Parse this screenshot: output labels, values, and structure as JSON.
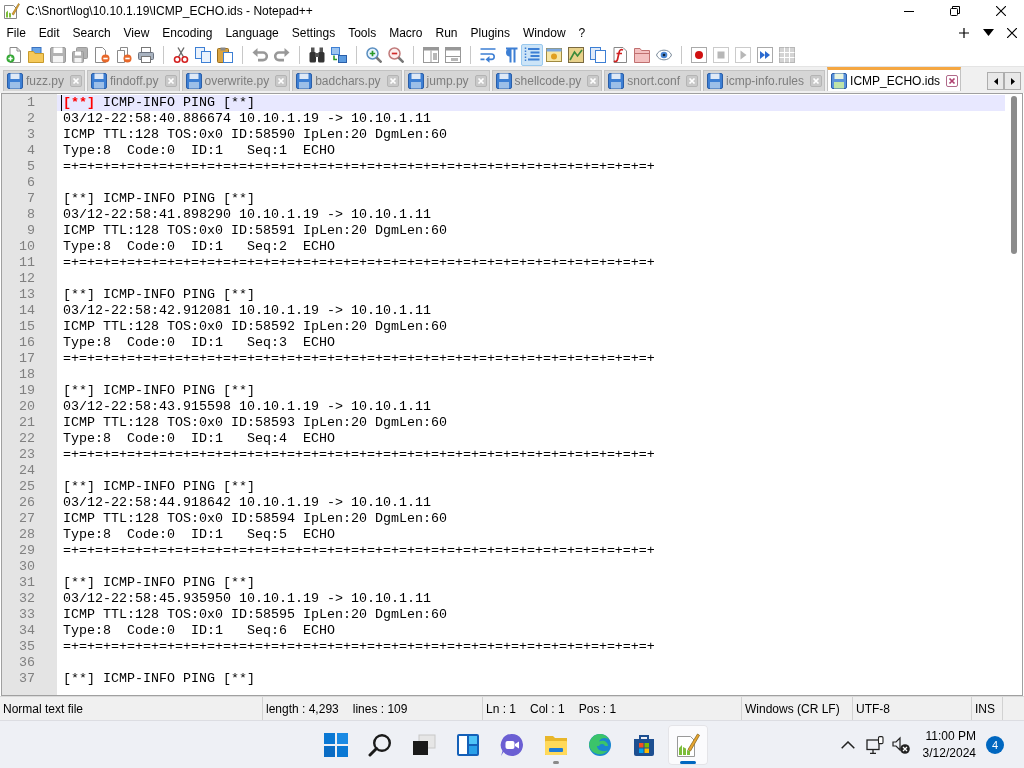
{
  "window": {
    "title": "C:\\Snort\\log\\10.10.1.19\\ICMP_ECHO.ids - Notepad++"
  },
  "menu": [
    "File",
    "Edit",
    "Search",
    "View",
    "Encoding",
    "Language",
    "Settings",
    "Tools",
    "Macro",
    "Run",
    "Plugins",
    "Window",
    "?"
  ],
  "toolbar": {
    "groups": [
      [
        {
          "kind": "new",
          "on": false,
          "disabled": false
        },
        {
          "kind": "open",
          "on": false,
          "disabled": false
        },
        {
          "kind": "save",
          "on": false,
          "disabled": true
        },
        {
          "kind": "saveall",
          "on": false,
          "disabled": true
        },
        {
          "kind": "close",
          "on": false,
          "disabled": false
        },
        {
          "kind": "closeall",
          "on": false,
          "disabled": false
        },
        {
          "kind": "print",
          "on": false,
          "disabled": false
        }
      ],
      [
        {
          "kind": "cut",
          "on": false,
          "disabled": false
        },
        {
          "kind": "copy",
          "on": false,
          "disabled": false
        },
        {
          "kind": "paste",
          "on": false,
          "disabled": false
        }
      ],
      [
        {
          "kind": "undo",
          "on": false,
          "disabled": true
        },
        {
          "kind": "redo",
          "on": false,
          "disabled": true
        }
      ],
      [
        {
          "kind": "find",
          "on": false,
          "disabled": false
        },
        {
          "kind": "replace",
          "on": false,
          "disabled": false
        }
      ],
      [
        {
          "kind": "zoomin",
          "on": false,
          "disabled": false
        },
        {
          "kind": "zoomout",
          "on": false,
          "disabled": false
        }
      ],
      [
        {
          "kind": "syncv",
          "on": false,
          "disabled": true
        },
        {
          "kind": "synch",
          "on": false,
          "disabled": true
        }
      ],
      [
        {
          "kind": "wrap",
          "on": false,
          "disabled": false
        },
        {
          "kind": "allchars",
          "on": false,
          "disabled": false
        },
        {
          "kind": "indent",
          "on": true,
          "disabled": false
        },
        {
          "kind": "udl",
          "on": false,
          "disabled": false
        },
        {
          "kind": "docmap",
          "on": false,
          "disabled": false
        },
        {
          "kind": "doclist",
          "on": false,
          "disabled": false
        },
        {
          "kind": "funclist",
          "on": false,
          "disabled": false
        },
        {
          "kind": "workspace",
          "on": false,
          "disabled": false
        },
        {
          "kind": "monitor",
          "on": false,
          "disabled": false
        }
      ],
      [
        {
          "kind": "record",
          "on": false,
          "disabled": false
        },
        {
          "kind": "stop",
          "on": false,
          "disabled": true
        },
        {
          "kind": "play",
          "on": false,
          "disabled": true
        },
        {
          "kind": "playmulti",
          "on": false,
          "disabled": false
        },
        {
          "kind": "savemacro",
          "on": false,
          "disabled": true
        }
      ]
    ]
  },
  "tabs": [
    {
      "label": "fuzz.py",
      "selected": false
    },
    {
      "label": "findoff.py",
      "selected": false
    },
    {
      "label": "overwrite.py",
      "selected": false
    },
    {
      "label": "badchars.py",
      "selected": false
    },
    {
      "label": "jump.py",
      "selected": false
    },
    {
      "label": "shellcode.py",
      "selected": false
    },
    {
      "label": "snort.conf",
      "selected": false
    },
    {
      "label": "icmp-info.rules",
      "selected": false
    },
    {
      "label": "ICMP_ECHO.ids",
      "selected": true
    }
  ],
  "editor": {
    "lines": [
      {
        "number": "1",
        "current": true,
        "segments": [
          {
            "text": "[**]",
            "kind": "brace"
          },
          {
            "text": " ICMP-INFO PING [**]",
            "kind": "plain"
          }
        ]
      },
      {
        "number": "2",
        "current": false,
        "text": "03/12-22:58:40.886674 10.10.1.19 -> 10.10.1.11"
      },
      {
        "number": "3",
        "current": false,
        "text": "ICMP TTL:128 TOS:0x0 ID:58590 IpLen:20 DgmLen:60"
      },
      {
        "number": "4",
        "current": false,
        "text": "Type:8  Code:0  ID:1   Seq:1  ECHO"
      },
      {
        "number": "5",
        "current": false,
        "text": "=+=+=+=+=+=+=+=+=+=+=+=+=+=+=+=+=+=+=+=+=+=+=+=+=+=+=+=+=+=+=+=+=+=+=+=+=+"
      },
      {
        "number": "6",
        "current": false
      },
      {
        "number": "7",
        "current": false,
        "text": "[**] ICMP-INFO PING [**]"
      },
      {
        "number": "8",
        "current": false,
        "text": "03/12-22:58:41.898290 10.10.1.19 -> 10.10.1.11"
      },
      {
        "number": "9",
        "current": false,
        "text": "ICMP TTL:128 TOS:0x0 ID:58591 IpLen:20 DgmLen:60"
      },
      {
        "number": "10",
        "current": false,
        "text": "Type:8  Code:0  ID:1   Seq:2  ECHO"
      },
      {
        "number": "11",
        "current": false,
        "text": "=+=+=+=+=+=+=+=+=+=+=+=+=+=+=+=+=+=+=+=+=+=+=+=+=+=+=+=+=+=+=+=+=+=+=+=+=+"
      },
      {
        "number": "12",
        "current": false
      },
      {
        "number": "13",
        "current": false,
        "text": "[**] ICMP-INFO PING [**]"
      },
      {
        "number": "14",
        "current": false,
        "text": "03/12-22:58:42.912081 10.10.1.19 -> 10.10.1.11"
      },
      {
        "number": "15",
        "current": false,
        "text": "ICMP TTL:128 TOS:0x0 ID:58592 IpLen:20 DgmLen:60"
      },
      {
        "number": "16",
        "current": false,
        "text": "Type:8  Code:0  ID:1   Seq:3  ECHO"
      },
      {
        "number": "17",
        "current": false,
        "text": "=+=+=+=+=+=+=+=+=+=+=+=+=+=+=+=+=+=+=+=+=+=+=+=+=+=+=+=+=+=+=+=+=+=+=+=+=+"
      },
      {
        "number": "18",
        "current": false
      },
      {
        "number": "19",
        "current": false,
        "text": "[**] ICMP-INFO PING [**]"
      },
      {
        "number": "20",
        "current": false,
        "text": "03/12-22:58:43.915598 10.10.1.19 -> 10.10.1.11"
      },
      {
        "number": "21",
        "current": false,
        "text": "ICMP TTL:128 TOS:0x0 ID:58593 IpLen:20 DgmLen:60"
      },
      {
        "number": "22",
        "current": false,
        "text": "Type:8  Code:0  ID:1   Seq:4  ECHO"
      },
      {
        "number": "23",
        "current": false,
        "text": "=+=+=+=+=+=+=+=+=+=+=+=+=+=+=+=+=+=+=+=+=+=+=+=+=+=+=+=+=+=+=+=+=+=+=+=+=+"
      },
      {
        "number": "24",
        "current": false
      },
      {
        "number": "25",
        "current": false,
        "text": "[**] ICMP-INFO PING [**]"
      },
      {
        "number": "26",
        "current": false,
        "text": "03/12-22:58:44.918642 10.10.1.19 -> 10.10.1.11"
      },
      {
        "number": "27",
        "current": false,
        "text": "ICMP TTL:128 TOS:0x0 ID:58594 IpLen:20 DgmLen:60"
      },
      {
        "number": "28",
        "current": false,
        "text": "Type:8  Code:0  ID:1   Seq:5  ECHO"
      },
      {
        "number": "29",
        "current": false,
        "text": "=+=+=+=+=+=+=+=+=+=+=+=+=+=+=+=+=+=+=+=+=+=+=+=+=+=+=+=+=+=+=+=+=+=+=+=+=+"
      },
      {
        "number": "30",
        "current": false
      },
      {
        "number": "31",
        "current": false,
        "text": "[**] ICMP-INFO PING [**]"
      },
      {
        "number": "32",
        "current": false,
        "text": "03/12-22:58:45.935950 10.10.1.19 -> 10.10.1.11"
      },
      {
        "number": "33",
        "current": false,
        "text": "ICMP TTL:128 TOS:0x0 ID:58595 IpLen:20 DgmLen:60"
      },
      {
        "number": "34",
        "current": false,
        "text": "Type:8  Code:0  ID:1   Seq:6  ECHO"
      },
      {
        "number": "35",
        "current": false,
        "text": "=+=+=+=+=+=+=+=+=+=+=+=+=+=+=+=+=+=+=+=+=+=+=+=+=+=+=+=+=+=+=+=+=+=+=+=+=+"
      },
      {
        "number": "36",
        "current": false
      },
      {
        "number": "37",
        "current": false,
        "text": "[**] ICMP-INFO PING [**]"
      }
    ]
  },
  "status_bar": [
    {
      "texts": [
        "Normal text file"
      ]
    },
    {
      "texts": [
        "length : 4,293",
        "lines : 109"
      ]
    },
    {
      "texts": [
        "Ln : 1",
        "Col : 1",
        "Pos : 1"
      ]
    },
    {
      "texts": [
        "Windows (CR LF)"
      ]
    },
    {
      "texts": [
        "UTF-8"
      ]
    },
    {
      "texts": [
        "INS"
      ]
    }
  ],
  "taskbar": {
    "apps": [
      {
        "kind": "start",
        "running": false,
        "active": false
      },
      {
        "kind": "search",
        "running": false,
        "active": false
      },
      {
        "kind": "taskview",
        "running": false,
        "active": false
      },
      {
        "kind": "widgets",
        "running": false,
        "active": false
      },
      {
        "kind": "chat",
        "running": false,
        "active": false
      },
      {
        "kind": "explorer",
        "running": true,
        "active": false
      },
      {
        "kind": "edge",
        "running": false,
        "active": false
      },
      {
        "kind": "store",
        "running": false,
        "active": false
      },
      {
        "kind": "notepadpp",
        "running": true,
        "active": true
      }
    ],
    "tray": {
      "time": "11:00 PM",
      "date": "3/12/2024",
      "notifications": "4"
    }
  }
}
